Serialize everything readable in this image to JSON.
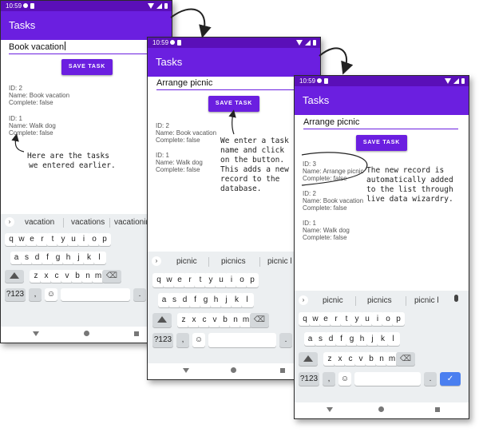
{
  "app_title": "Tasks",
  "save_label": "SAVE TASK",
  "keys_row1": [
    "q",
    "w",
    "e",
    "r",
    "t",
    "y",
    "u",
    "i",
    "o",
    "p"
  ],
  "keys_row2": [
    "a",
    "s",
    "d",
    "f",
    "g",
    "h",
    "j",
    "k",
    "l"
  ],
  "keys_row3": [
    "z",
    "x",
    "c",
    "v",
    "b",
    "n",
    "m"
  ],
  "sym_key": "?123",
  "comma_key": ",",
  "period_key": ".",
  "phone1": {
    "time": "10:59",
    "input_value": "Book vacation",
    "records": [
      {
        "id": "ID: 2",
        "name": "Name: Book vacation",
        "complete": "Complete: false"
      },
      {
        "id": "ID: 1",
        "name": "Name: Walk dog",
        "complete": "Complete: false"
      }
    ],
    "suggestions": [
      "vacation",
      "vacations",
      "vacationin"
    ]
  },
  "phone2": {
    "time": "10:59",
    "input_value": "Arrange picnic",
    "records": [
      {
        "id": "ID: 2",
        "name": "Name: Book vacation",
        "complete": "Complete: false"
      },
      {
        "id": "ID: 1",
        "name": "Name: Walk dog",
        "complete": "Complete: false"
      }
    ],
    "suggestions": [
      "picnic",
      "picnics",
      "picnic l"
    ]
  },
  "phone3": {
    "time": "10:59",
    "input_value": "Arrange picnic",
    "records": [
      {
        "id": "ID: 3",
        "name": "Name: Arrange picnic",
        "complete": "Complete: false"
      },
      {
        "id": "ID: 2",
        "name": "Name: Book vacation",
        "complete": "Complete: false"
      },
      {
        "id": "ID: 1",
        "name": "Name: Walk dog",
        "complete": "Complete: false"
      }
    ],
    "suggestions": [
      "picnic",
      "picnics",
      "picnic l"
    ]
  },
  "annotations": {
    "note1": [
      "Here are the tasks",
      "we entered earlier."
    ],
    "note2": [
      "We enter a task",
      "name and click",
      "on the button.",
      "This adds a new",
      "record to the",
      "database."
    ],
    "note3": [
      "The new record is",
      "automatically added",
      "to the list through",
      "live data wizardry."
    ]
  },
  "colors": {
    "purple": "#6b1fe0",
    "status_purple": "#5a0fb8",
    "keyboard": "#eceff1",
    "enter_key": "#4a7ff0"
  },
  "icons": [
    "gear-icon",
    "sim-card-icon",
    "wifi-icon",
    "signal-icon",
    "battery-icon",
    "expand-arrow-icon",
    "mic-icon",
    "backspace-icon",
    "shift-icon",
    "emoji-icon",
    "enter-check-icon",
    "nav-back-icon",
    "nav-home-icon",
    "nav-recents-icon"
  ]
}
